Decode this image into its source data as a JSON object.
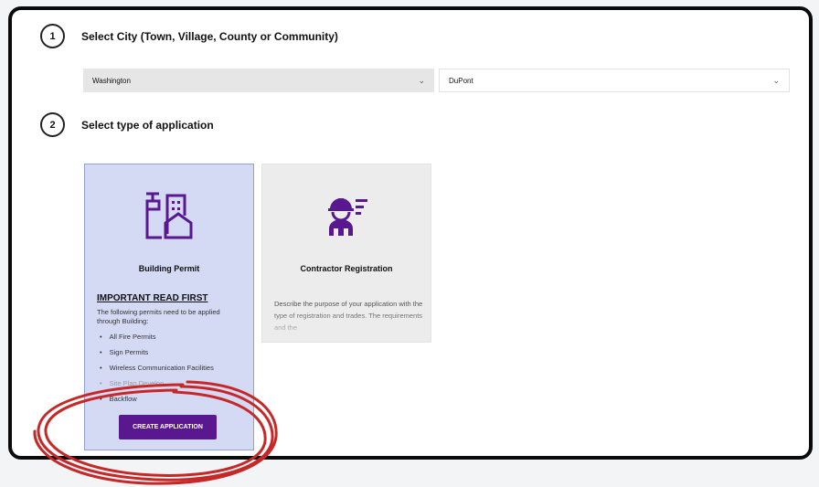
{
  "steps": {
    "step1": {
      "number": "1",
      "title": "Select City (Town, Village, County or Community)"
    },
    "step2": {
      "number": "2",
      "title": "Select type of application"
    }
  },
  "selects": {
    "state": {
      "value": "Washington",
      "icon": "chevron-down-icon"
    },
    "city": {
      "value": "DuPont",
      "icon": "chevron-down-icon"
    }
  },
  "cards": {
    "building": {
      "title": "Building Permit",
      "icon": "building-icon",
      "important": "IMPORTANT READ FIRST",
      "intro": "The following permits need to be applied through Building:",
      "items": [
        "All Fire Permits",
        "Sign Permits",
        "Wireless Communication Facilities",
        "Site Plan Develop...",
        "Backflow"
      ],
      "button": "CREATE APPLICATION"
    },
    "contractor": {
      "title": "Contractor Registration",
      "icon": "construction-worker-icon",
      "description": "Describe the purpose of your application with the type of registration and trades. The requirements and the"
    }
  },
  "colors": {
    "accent": "#5a1890",
    "selected_card": "#d4daf4",
    "annotation": "#c62828"
  }
}
